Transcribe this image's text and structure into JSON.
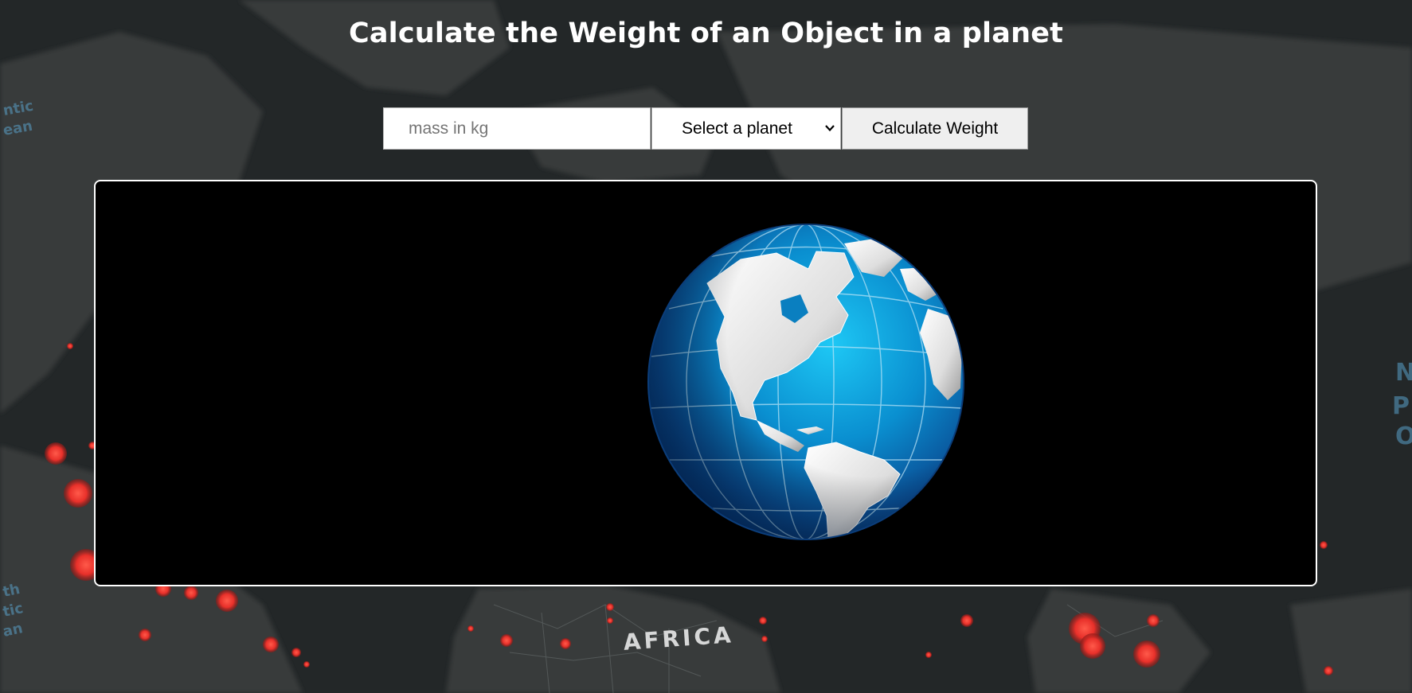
{
  "page": {
    "title": "Calculate the Weight of an Object in a planet"
  },
  "form": {
    "mass_placeholder": "mass in kg",
    "mass_value": "",
    "planet_select_label": "Select a planet",
    "calculate_button_label": "Calculate Weight"
  },
  "background": {
    "map_label": "AFRICA",
    "colors": {
      "ocean": "#232728",
      "land": "#3a3f3d",
      "hotspot": "#e8302a"
    }
  },
  "display": {
    "image": "earth-globe-icon",
    "colors": {
      "panel": "#000000",
      "border": "#ffffff",
      "ocean": "#0a8fd0",
      "land": "#e6e6e6"
    }
  }
}
